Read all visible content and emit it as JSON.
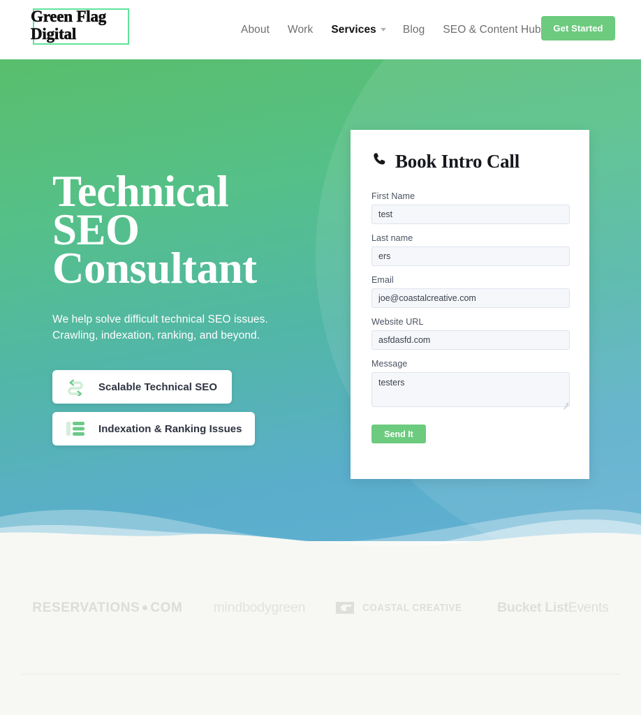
{
  "brand": {
    "logo_line1": "Green Flag",
    "logo_line2": "Digital",
    "accent_green": "#6ccb7e",
    "logo_border_green": "#5fe39a"
  },
  "header": {
    "nav": [
      {
        "label": "About",
        "active": false
      },
      {
        "label": "Work",
        "active": false
      },
      {
        "label": "Services",
        "active": true,
        "has_dropdown": true
      },
      {
        "label": "Blog",
        "active": false
      },
      {
        "label": "SEO & Content Hub",
        "active": false
      }
    ],
    "cta_label": "Get Started"
  },
  "hero": {
    "title_line1": "Technical",
    "title_line2": "SEO",
    "title_line3": "Consultant",
    "sub_line1": "We help solve difficult technical SEO issues.",
    "sub_line2": "Crawling, indexation, ranking, and beyond.",
    "features": [
      {
        "label": "Scalable Technical SEO",
        "icon": "winding-arrows-icon"
      },
      {
        "label": "Indexation & Ranking Issues",
        "icon": "list-bars-icon"
      }
    ],
    "gradient_top": "#59be6c",
    "gradient_bottom": "#62b0d3"
  },
  "form": {
    "title": "Book Intro Call",
    "title_icon": "phone-icon",
    "fields": [
      {
        "label": "First Name",
        "value": "test",
        "type": "text"
      },
      {
        "label": "Last name",
        "value": "ers",
        "type": "text"
      },
      {
        "label": "Email",
        "value": "joe@coastalcreative.com",
        "type": "text"
      },
      {
        "label": "Website URL",
        "value": "asfdasfd.com",
        "type": "text"
      },
      {
        "label": "Message",
        "value": "testers",
        "type": "textarea"
      }
    ],
    "submit_label": "Send It"
  },
  "clients": {
    "items": [
      {
        "name": "RESERVATIONS",
        "suffix": "COM",
        "style": "reservations"
      },
      {
        "name": "mindbodygreen",
        "style": "mindbodygreen"
      },
      {
        "name": "COASTAL CREATIVE",
        "style": "coastal"
      },
      {
        "name": "Bucket List",
        "suffix": "Events",
        "style": "bucketlist"
      }
    ]
  }
}
